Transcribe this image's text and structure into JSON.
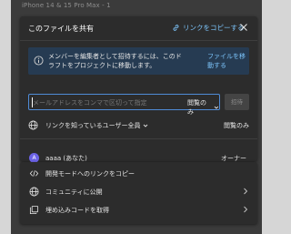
{
  "background": {
    "device_label": "iPhone 14 & 15 Pro Max - 1"
  },
  "dialog": {
    "title": "このファイルを共有",
    "copy_link_label": "リンクをコピーする",
    "banner": {
      "text": "メンバーを編集者として招待するには、このドラフトをプロジェクトに移動します。",
      "link_label": "ファイルを移動する"
    },
    "invite": {
      "placeholder": "メールアドレスをコンマで区切って指定",
      "permission": "閲覧のみ",
      "button_label": "招待"
    },
    "general_access": {
      "label": "リンクを知っているユーザー全員",
      "permission": "閲覧のみ"
    },
    "members": [
      {
        "avatar_letter": "A",
        "name": "aaaa (あなた)",
        "role": "オーナー",
        "avatar_color": "#6c63e6"
      }
    ]
  },
  "footer": {
    "items": [
      {
        "label": "開発モードへのリンクをコピー",
        "icon": "code-icon"
      },
      {
        "label": "コミュニティに公開",
        "icon": "globe-icon"
      },
      {
        "label": "埋め込みコードを取得",
        "icon": "embed-copy-icon"
      }
    ]
  },
  "colors": {
    "accent": "#7cc4fa",
    "panel": "#2c2c2c",
    "banner": "#263b52",
    "focus": "#4f8bd6"
  }
}
